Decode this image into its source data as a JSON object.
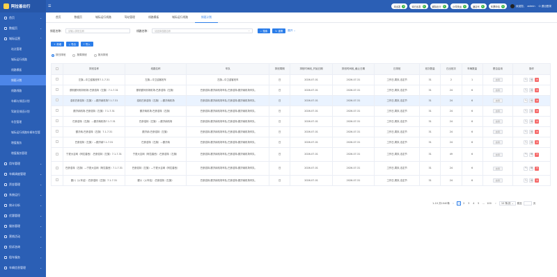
{
  "app": {
    "title": "阿拉善出行"
  },
  "sidebar": {
    "items": [
      {
        "label": "首页",
        "icon": "home-icon"
      },
      {
        "label": "数据页",
        "icon": "data-icon"
      },
      {
        "label": "城际运营",
        "icon": "car-icon",
        "expanded": true,
        "children": [
          {
            "label": "站点管理"
          },
          {
            "label": "城际运行线路"
          },
          {
            "label": "线路模板"
          },
          {
            "label": "排班计划",
            "active": true
          },
          {
            "label": "线路线路"
          },
          {
            "label": "车辆与排班计划"
          },
          {
            "label": "驾驶员排班计划"
          },
          {
            "label": "车型管理"
          },
          {
            "label": "城际运行线路车辆车型管"
          },
          {
            "label": "增值服务"
          },
          {
            "label": "增值服务管理"
          }
        ]
      },
      {
        "label": "用车管理",
        "icon": "car2-icon"
      },
      {
        "label": "车辆调度管理",
        "icon": "dispatch-icon"
      },
      {
        "label": "资金管理",
        "icon": "money-icon"
      },
      {
        "label": "系统运行",
        "icon": "system-icon"
      },
      {
        "label": "统计分析",
        "icon": "chart-icon"
      },
      {
        "label": "优惠管理",
        "icon": "coupon-icon"
      },
      {
        "label": "服务管理",
        "icon": "service-icon"
      },
      {
        "label": "营销活动",
        "icon": "activity-icon"
      },
      {
        "label": "投诉咨询",
        "icon": "complaint-icon"
      },
      {
        "label": "租车服务",
        "icon": "rent-icon"
      },
      {
        "label": "车辆信息管理",
        "icon": "vehicle-icon"
      }
    ]
  },
  "topbar": {
    "quick": [
      {
        "label": "未出发",
        "count": "0"
      },
      {
        "label": "待已出发",
        "count": "0"
      },
      {
        "label": "城际出行",
        "count": "0"
      },
      {
        "label": "小件快运",
        "count": "0"
      },
      {
        "label": "酒店代",
        "count": "0"
      },
      {
        "label": "车票申请",
        "count": "0"
      }
    ],
    "user": "admin",
    "user_prefix": "欢迎您，",
    "logout": "退出登录"
  },
  "tabs": [
    "首页",
    "数据页",
    "城际运行线路",
    "驾站管理",
    "线路模板",
    "城际运行线路",
    "排班计划"
  ],
  "search": {
    "name_label": "排班名称：",
    "name_placeholder": "请输入排班名称",
    "line_label": "线路名称：",
    "line_placeholder": "请选择线路名称",
    "search_btn": "搜索",
    "reset_btn": "重置",
    "expand": "展开"
  },
  "actions": {
    "add": "新增",
    "export": "导出",
    "import": "导入"
  },
  "radios": [
    {
      "label": "按日排班",
      "checked": true
    },
    {
      "label": "按周排班",
      "checked": false
    },
    {
      "label": "按月排班",
      "checked": false
    }
  ],
  "table": {
    "columns": [
      "",
      "排班名称",
      "线路名称",
      "车队",
      "排班周期",
      "排班时间段_开始日期",
      "排班时间段_截止日期",
      "日排班",
      "班次数量",
      "已出班次",
      "车辆数量",
      "是否启用",
      "操作"
    ],
    "rows": [
      {
        "name": "左旗—中卫迎客班车7.1-7.31",
        "line": "左旗—中卫迎客班车",
        "fleet": "左旗—中卫迎客班车",
        "cycle": "日",
        "start": "2026-07-01",
        "end": "2026-07-31",
        "daily": "工作日,周末,法定节",
        "shifts": "31",
        "out": "2",
        "vehicles": "1",
        "enable": "启用"
      },
      {
        "name": "额机额河机场机场-巴彦浩特（左旗）7.1-7.31",
        "line": "额机额河机场机场-巴彦浩特（左旗）",
        "fleet": "巴彦浩特-额济纳机场车队,巴彦浩特-额济纳机场车队,",
        "cycle": "日",
        "start": "2026-07-01",
        "end": "2026-07-31",
        "daily": "工作日,周末,法定节",
        "shifts": "31",
        "out": "24",
        "vehicles": "6",
        "enable": "启用"
      },
      {
        "name": "浩机巴彦浩特（左旗）—额济纳机场7.1-7.31",
        "line": "浩机巴彦浩特（左旗）—额济纳机场",
        "fleet": "巴彦浩特-额济纳机场车队,巴彦浩特-额济纳机场车队,",
        "cycle": "日",
        "start": "2026-07-01",
        "end": "2026-07-31",
        "daily": "工作日,周末,法定节",
        "shifts": "31",
        "out": "24",
        "vehicles": "6",
        "enable": "启用",
        "highlight": true
      },
      {
        "name": "额济纳机场-巴彦浩特（左旗）7.1-7.31",
        "line": "额济纳机场-巴彦浩特（左旗）",
        "fleet": "巴彦浩特-额济纳机场车队,巴彦浩特-额济纳机场车队,",
        "cycle": "日",
        "start": "2026-07-01",
        "end": "2026-07-31",
        "daily": "工作日,周末,法定节",
        "shifts": "31",
        "out": "24",
        "vehicles": "6",
        "enable": "启用"
      },
      {
        "name": "巴彦浩特（左旗）—额济纳机场7.1-7.31",
        "line": "巴彦浩特（左旗）—额济纳机场",
        "fleet": "巴彦浩特-额济纳机场车队,巴彦浩特-额济纳机场车队,",
        "cycle": "日",
        "start": "2026-07-01",
        "end": "2026-07-31",
        "daily": "工作日,周末,法定节",
        "shifts": "31",
        "out": "24",
        "vehicles": "6",
        "enable": "启用"
      },
      {
        "name": "额济纳-巴彦浩特（左旗）7.1-7.31",
        "line": "额济纳-巴彦浩特（左旗）",
        "fleet": "巴彦浩特-额济纳机场车队,巴彦浩特-额济纳机场车队,",
        "cycle": "日",
        "start": "2026-07-01",
        "end": "2026-07-31",
        "daily": "工作日,周末,法定节",
        "shifts": "31",
        "out": "24",
        "vehicles": "6",
        "enable": "启用"
      },
      {
        "name": "巴彦浩特（左旗）—额济纳7.1-7.31",
        "line": "巴彦浩特（左旗）—额济纳",
        "fleet": "巴彦浩特-额济纳机场车队,巴彦浩特-额济纳机场车队,",
        "cycle": "日",
        "start": "2026-07-01",
        "end": "2026-07-31",
        "daily": "工作日,周末,法定节",
        "shifts": "31",
        "out": "24",
        "vehicles": "6",
        "enable": "启用"
      },
      {
        "name": "宁夏大吉网（阿拉善西）-巴彦浩特（左旗）7.1-7.31",
        "line": "宁夏大吉网（阿拉善西）-巴彦浩特（左旗）",
        "fleet": "巴彦浩特-额济纳机场车队,巴彦浩特-额济纳机场车队,",
        "cycle": "日",
        "start": "2026-07-01",
        "end": "2026-07-31",
        "daily": "工作日,周末,法定节",
        "shifts": "31",
        "out": "49",
        "vehicles": "6",
        "enable": "启用",
        "tall": true
      },
      {
        "name": "巴彦浩特（左旗）—宁夏大吉网（阿拉善西）7.1-7.31",
        "line": "巴彦浩特（左旗）—宁夏大吉网（阿拉善西）",
        "fleet": "巴彦浩特-额济纳机场车队,巴彦浩特-额济纳机场车队,",
        "cycle": "日",
        "start": "2026-07-01",
        "end": "2026-07-31",
        "daily": "工作日,周末,法定节",
        "shifts": "31",
        "out": "24",
        "vehicles": "6",
        "enable": "启用",
        "tall": true
      },
      {
        "name": "额川（火车站）-巴彦浩特（左旗）7.1-7.31",
        "line": "额川（火车站）-巴彦浩特（左旗）",
        "fleet": "巴彦浩特-额济纳机场车队,巴彦浩特-额济纳机场车队,",
        "cycle": "日",
        "start": "2026-07-01",
        "end": "2026-07-31",
        "daily": "工作日,周末,法定节",
        "shifts": "31",
        "out": "24",
        "vehicles": "6",
        "enable": "启用"
      }
    ]
  },
  "pagination": {
    "summary": "1-10 共1040条",
    "prev": "‹",
    "pages": [
      "1",
      "2",
      "3",
      "4",
      "5",
      "...",
      "100"
    ],
    "current": "1",
    "next": "›",
    "page_size": "10 条/页",
    "goto_label": "跳至",
    "goto_suffix": "页"
  }
}
